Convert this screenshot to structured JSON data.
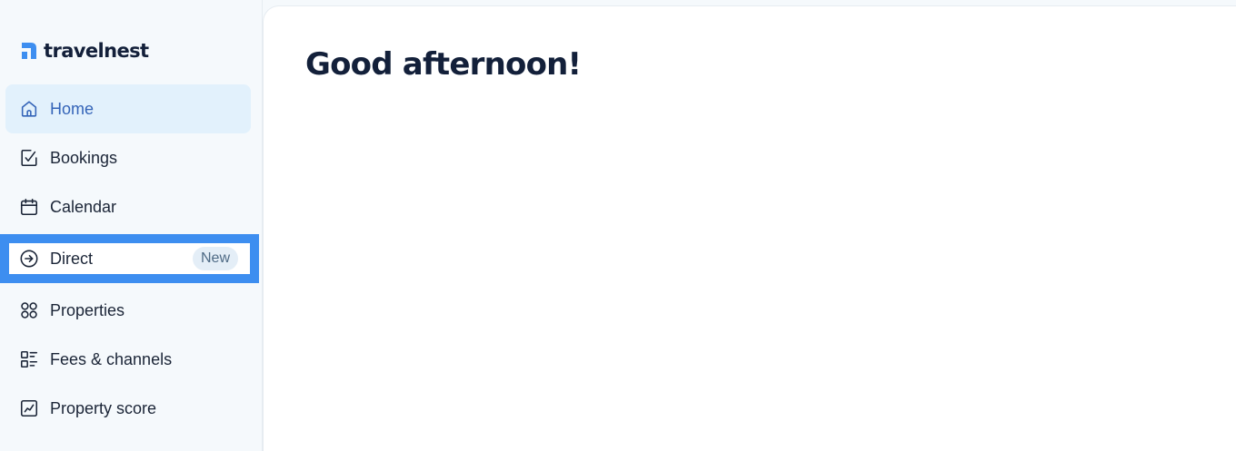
{
  "brand": {
    "name": "travelnest",
    "logo_icon": "travelnest-logo-icon",
    "accent": "#3d8ef0"
  },
  "sidebar": {
    "items": [
      {
        "label": "Home",
        "icon": "home-icon",
        "state": "active"
      },
      {
        "label": "Bookings",
        "icon": "bookings-check-icon"
      },
      {
        "label": "Calendar",
        "icon": "calendar-icon"
      },
      {
        "label": "Direct",
        "icon": "arrow-circle-right-icon",
        "badge": "New",
        "state": "selected"
      },
      {
        "label": "Properties",
        "icon": "grid-circles-icon"
      },
      {
        "label": "Fees & channels",
        "icon": "fees-list-icon"
      },
      {
        "label": "Property score",
        "icon": "chart-line-icon"
      }
    ]
  },
  "main": {
    "greeting": "Good afternoon!"
  }
}
